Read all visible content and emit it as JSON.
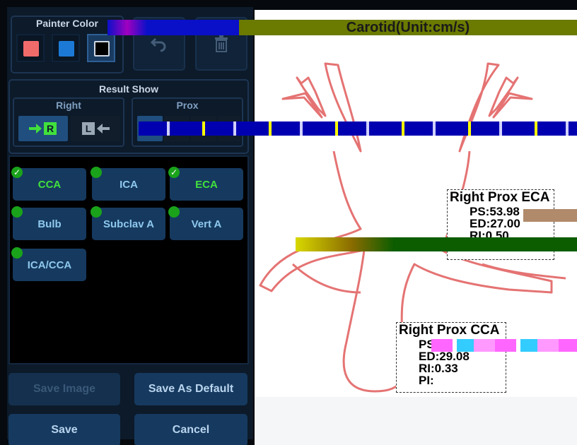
{
  "painter": {
    "title": "Painter Color",
    "colors": [
      "#f26b6b",
      "#1c7ad6",
      "#000000"
    ],
    "selected_index": 2
  },
  "toolbar": {
    "undo_icon": "undo-icon",
    "delete_icon": "trash-icon"
  },
  "result_show": {
    "title": "Result Show",
    "side": {
      "title": "Right",
      "options": [
        "R",
        "L"
      ],
      "selected": "R"
    },
    "position": {
      "title": "Prox"
    }
  },
  "vessels": [
    {
      "label": "CCA",
      "checked": true
    },
    {
      "label": "ICA",
      "checked": false
    },
    {
      "label": "ECA",
      "checked": true
    },
    {
      "label": "Bulb",
      "checked": false
    },
    {
      "label": "Subclav A",
      "checked": false
    },
    {
      "label": "Vert A",
      "checked": false
    },
    {
      "label": "ICA/CCA",
      "checked": false
    }
  ],
  "buttons": {
    "save_image": "Save Image",
    "save_default": "Save As Default",
    "save": "Save",
    "cancel": "Cancel"
  },
  "diagram": {
    "title": "Carotid(Unit:cm/s)",
    "vessel_color": "#e57373",
    "eca_box": {
      "title": "Right Prox ECA",
      "lines": [
        "PS:53.98",
        "ED:27.00",
        "RI:0.50",
        "PI:"
      ]
    },
    "cca_box": {
      "title": "Right Prox CCA",
      "lines": [
        "PS:4",
        "ED:29.08",
        "RI:0.33",
        "PI:"
      ]
    }
  }
}
